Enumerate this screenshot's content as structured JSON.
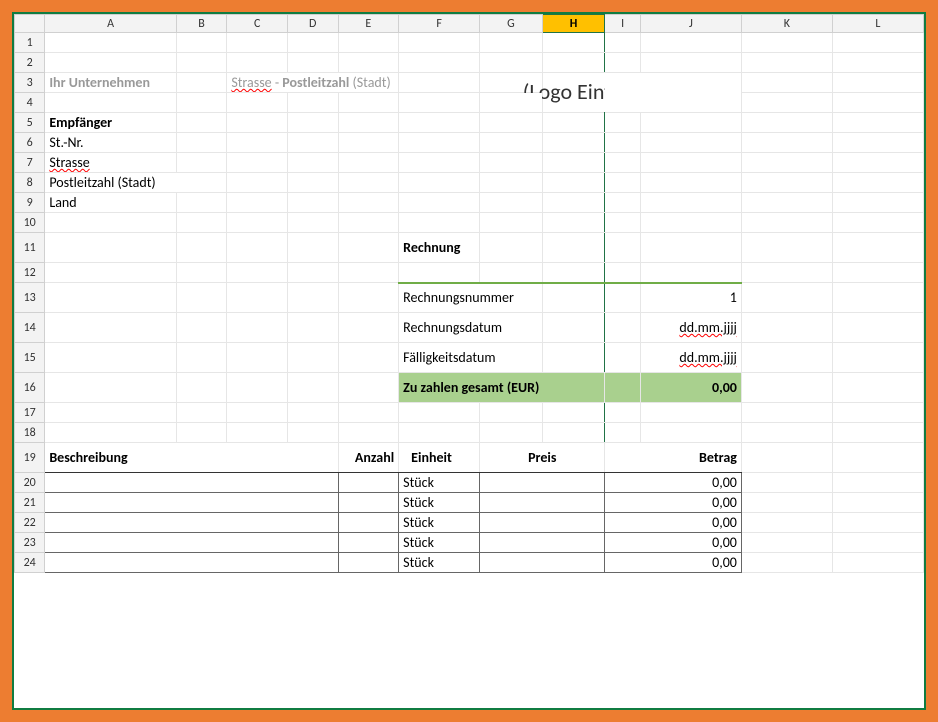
{
  "columns": [
    "",
    "A",
    "B",
    "C",
    "D",
    "E",
    "F",
    "G",
    "H",
    "I",
    "J",
    "K",
    "L"
  ],
  "selected_column": "H",
  "rows": [
    1,
    2,
    3,
    4,
    5,
    6,
    7,
    8,
    9,
    10,
    11,
    12,
    13,
    14,
    15,
    16,
    17,
    18,
    19,
    20,
    21,
    22,
    23,
    24
  ],
  "header": {
    "company": "Ihr Unternehmen",
    "address_street": "Strasse",
    "address_sep": " - ",
    "address_zip": "Postleitzahl",
    "address_city": " (Stadt)",
    "logo_text": "(Logo Einfügen)"
  },
  "recipient": {
    "title": "Empfänger",
    "tax_no": "St.-Nr.",
    "street": "Strasse",
    "zip_city": "Postleitzahl (Stadt)",
    "country": "Land"
  },
  "invoice": {
    "title": "Rechnung",
    "number_label": "Rechnungsnummer",
    "number_value": "1",
    "date_label": "Rechnungsdatum",
    "date_value": "dd.mm.jjjj",
    "due_label": "Fälligkeitsdatum",
    "due_value": "dd.mm.jjjj",
    "total_label": "Zu zahlen gesamt (EUR)",
    "total_value": "0,00"
  },
  "table": {
    "col_desc": "Beschreibung",
    "col_qty": "Anzahl",
    "col_unit": "Einheit",
    "col_price": "Preis",
    "col_amount": "Betrag",
    "rows": [
      {
        "unit": "Stück",
        "amount": "0,00"
      },
      {
        "unit": "Stück",
        "amount": "0,00"
      },
      {
        "unit": "Stück",
        "amount": "0,00"
      },
      {
        "unit": "Stück",
        "amount": "0,00"
      },
      {
        "unit": "Stück",
        "amount": "0,00"
      }
    ]
  }
}
